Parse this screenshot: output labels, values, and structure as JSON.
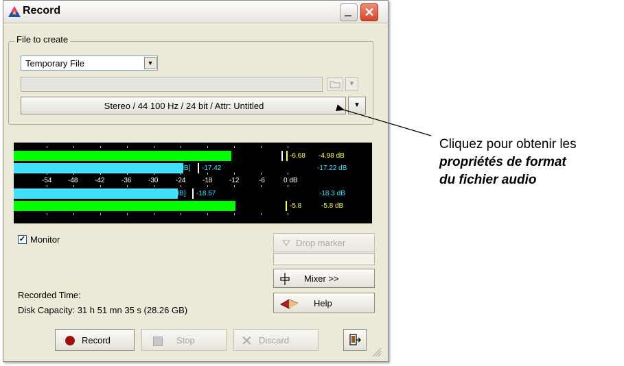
{
  "window": {
    "title": "Record",
    "close_glyph": "✕"
  },
  "file_group": {
    "label": "File to create",
    "file_type": "Temporary File",
    "format": "Stereo / 44 100 Hz / 24 bit / Attr: Untitled"
  },
  "meter": {
    "scale": [
      "-54",
      "-48",
      "-42",
      "-36",
      "-30",
      "-24",
      "-18",
      "-12",
      "-6",
      "0 dB"
    ],
    "left_peak_level_db": -6.68,
    "left_rms_level_db": -17.42,
    "right_rms_level_db": -18.57,
    "right_peak_level_db": -5.8,
    "left_peak_label": "-6.68",
    "left_rms_label": "-17.42",
    "left_rms_box": "[0.5 dB]",
    "right_rms_label": "-18.57",
    "right_rms_box": "[0.5 dB]",
    "right_peak_label": "-5.8",
    "readout": [
      "-4.98 dB",
      "-17.22 dB",
      "-18.3 dB",
      "-5.8 dB"
    ],
    "colors": {
      "peak": "#00ff00",
      "rms": "#40e0ff",
      "background": "#000000"
    }
  },
  "controls": {
    "monitor_label": "Monitor",
    "monitor_checked": true,
    "drop_marker_label": "Drop marker",
    "mixer_label": "Mixer >>",
    "help_label": "Help",
    "recorded_time_label": "Recorded Time:",
    "disk_capacity": "Disk Capacity: 31 h 51 mn 35 s (28.26 GB)",
    "record_label": "Record",
    "stop_label": "Stop",
    "discard_label": "Discard"
  },
  "annotation": {
    "line1": "Cliquez pour obtenir les",
    "line2": "propriétés de format",
    "line3": "du fichier audio"
  }
}
